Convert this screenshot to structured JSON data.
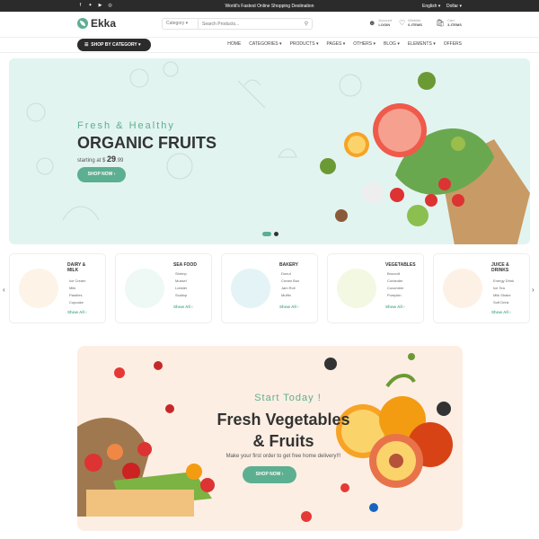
{
  "topbar": {
    "social_icons": [
      "facebook-icon",
      "twitter-icon",
      "youtube-icon",
      "instagram-icon"
    ],
    "tagline": "World's Fastest Online Shopping Destination",
    "language": "English",
    "currency": "Dollar"
  },
  "header": {
    "logo_text": "Ekka",
    "search": {
      "category": "Category",
      "placeholder": "Search Products..."
    },
    "account": {
      "line1": "Account",
      "line2": "LOGIN"
    },
    "wishlist": {
      "line1": "Wishlist",
      "line2": "0-ITEMS"
    },
    "cart": {
      "line1": "Cart",
      "line2": "3-ITEMS"
    }
  },
  "nav": {
    "by_category": "SHOP BY CATEGORY",
    "links": [
      "HOME",
      "CATEGORIES",
      "PRODUCTS",
      "PAGES",
      "OTHERS",
      "BLOG",
      "ELEMENTS",
      "OFFERS"
    ]
  },
  "hero": {
    "subtitle": "Fresh & Healthy",
    "title": "ORGANIC FRUITS",
    "starting_label": "starting at $",
    "price_main": "29",
    "price_cents": ".99",
    "button": "SHOP NOW"
  },
  "categories": [
    {
      "title_line1": "DAIRY &",
      "title_line2": "MILK",
      "items": [
        "Ice Cream",
        "Milk",
        "Pastries",
        "Cupcake"
      ],
      "show": "Show All",
      "color": "#fdf3e7"
    },
    {
      "title_line1": "SEA FOOD",
      "title_line2": "",
      "items": [
        "Shrimp",
        "Mussel",
        "Lobster",
        "Scallop"
      ],
      "show": "Show All",
      "color": "#eef8f4"
    },
    {
      "title_line1": "BAKERY",
      "title_line2": "",
      "items": [
        "Donut",
        "Cream Bun",
        "Jam Roll",
        "Muffin"
      ],
      "show": "Show All",
      "color": "#e3f3f6"
    },
    {
      "title_line1": "VEGETABLES",
      "title_line2": "",
      "items": [
        "Broccoli",
        "Coriander",
        "Cucumber",
        "Pumpkin"
      ],
      "show": "Show All",
      "color": "#f3f8e3"
    },
    {
      "title_line1": "JUICE &",
      "title_line2": "DRINKS",
      "items": [
        "Energy Drink",
        "Ice Tea",
        "Milk Shake",
        "Soft Drink"
      ],
      "show": "Show All",
      "color": "#fdf1e6"
    }
  ],
  "promo": {
    "kicker": "Start Today !",
    "line1": "Fresh Vegetables",
    "line2": "& Fruits",
    "desc": "Make your first order to get free home delivery!!!",
    "button": "SHOP NOW"
  },
  "colors": {
    "accent": "#5caf90",
    "dark": "#2b2b2b",
    "hero_bg": "#e2f4f0",
    "promo_bg": "#fdeee3"
  }
}
